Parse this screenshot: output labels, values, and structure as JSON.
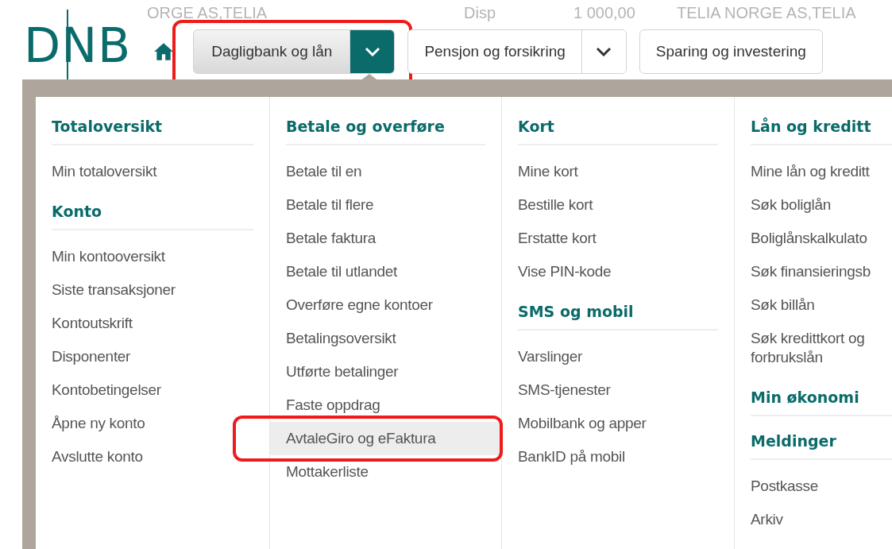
{
  "background_text": [
    "ORGE AS,TELIA",
    "Disp",
    "1 000,00",
    "TELIA NORGE AS,TELIA"
  ],
  "logo": {
    "text": "DNB"
  },
  "nav_tabs": [
    {
      "label": "Dagligbank og lån",
      "selected": true,
      "highlighted": true
    },
    {
      "label": "Pensjon og forsikring",
      "selected": false,
      "highlighted": false
    },
    {
      "label": "Sparing og investering",
      "selected": false,
      "highlighted": false
    }
  ],
  "menu_columns": [
    {
      "sections": [
        {
          "heading": "Totaloversikt",
          "items": [
            {
              "label": "Min totaloversikt",
              "selected": false,
              "highlighted": false
            }
          ]
        },
        {
          "heading": "Konto",
          "items": [
            {
              "label": "Min kontooversikt",
              "selected": false,
              "highlighted": false
            },
            {
              "label": "Siste transaksjoner",
              "selected": false,
              "highlighted": false
            },
            {
              "label": "Kontoutskrift",
              "selected": false,
              "highlighted": false
            },
            {
              "label": "Disponenter",
              "selected": false,
              "highlighted": false
            },
            {
              "label": "Kontobetingelser",
              "selected": false,
              "highlighted": false
            },
            {
              "label": "Åpne ny konto",
              "selected": false,
              "highlighted": false
            },
            {
              "label": "Avslutte konto",
              "selected": false,
              "highlighted": false
            }
          ]
        }
      ]
    },
    {
      "sections": [
        {
          "heading": "Betale og overføre",
          "items": [
            {
              "label": "Betale til en",
              "selected": false,
              "highlighted": false
            },
            {
              "label": "Betale til flere",
              "selected": false,
              "highlighted": false
            },
            {
              "label": "Betale faktura",
              "selected": false,
              "highlighted": false
            },
            {
              "label": "Betale til utlandet",
              "selected": false,
              "highlighted": false
            },
            {
              "label": "Overføre egne kontoer",
              "selected": false,
              "highlighted": false
            },
            {
              "label": "Betalingsoversikt",
              "selected": false,
              "highlighted": false
            },
            {
              "label": "Utførte betalinger",
              "selected": false,
              "highlighted": false
            },
            {
              "label": "Faste oppdrag",
              "selected": false,
              "highlighted": false
            },
            {
              "label": "AvtaleGiro og eFaktura",
              "selected": true,
              "highlighted": true
            },
            {
              "label": "Mottakerliste",
              "selected": false,
              "highlighted": false
            }
          ]
        }
      ]
    },
    {
      "sections": [
        {
          "heading": "Kort",
          "items": [
            {
              "label": "Mine kort",
              "selected": false,
              "highlighted": false
            },
            {
              "label": "Bestille kort",
              "selected": false,
              "highlighted": false
            },
            {
              "label": "Erstatte kort",
              "selected": false,
              "highlighted": false
            },
            {
              "label": "Vise PIN-kode",
              "selected": false,
              "highlighted": false
            }
          ]
        },
        {
          "heading": "SMS og mobil",
          "items": [
            {
              "label": "Varslinger",
              "selected": false,
              "highlighted": false
            },
            {
              "label": "SMS-tjenester",
              "selected": false,
              "highlighted": false
            },
            {
              "label": "Mobilbank og apper",
              "selected": false,
              "highlighted": false
            },
            {
              "label": "BankID på mobil",
              "selected": false,
              "highlighted": false
            }
          ]
        }
      ]
    },
    {
      "sections": [
        {
          "heading": "Lån og kreditt",
          "items": [
            {
              "label": "Mine lån og kreditt",
              "selected": false,
              "highlighted": false
            },
            {
              "label": "Søk boliglån",
              "selected": false,
              "highlighted": false
            },
            {
              "label": "Boliglånskalkulato",
              "selected": false,
              "highlighted": false
            },
            {
              "label": "Søk finansieringsb",
              "selected": false,
              "highlighted": false
            },
            {
              "label": "Søk billån",
              "selected": false,
              "highlighted": false
            },
            {
              "label": "Søk kredittkort og forbrukslån",
              "selected": false,
              "highlighted": false
            }
          ]
        },
        {
          "heading": "Min økonomi"
        },
        {
          "heading": "Meldinger",
          "items": [
            {
              "label": "Postkasse",
              "selected": false,
              "highlighted": false
            },
            {
              "label": "Arkiv",
              "selected": false,
              "highlighted": false
            }
          ]
        }
      ]
    }
  ]
}
